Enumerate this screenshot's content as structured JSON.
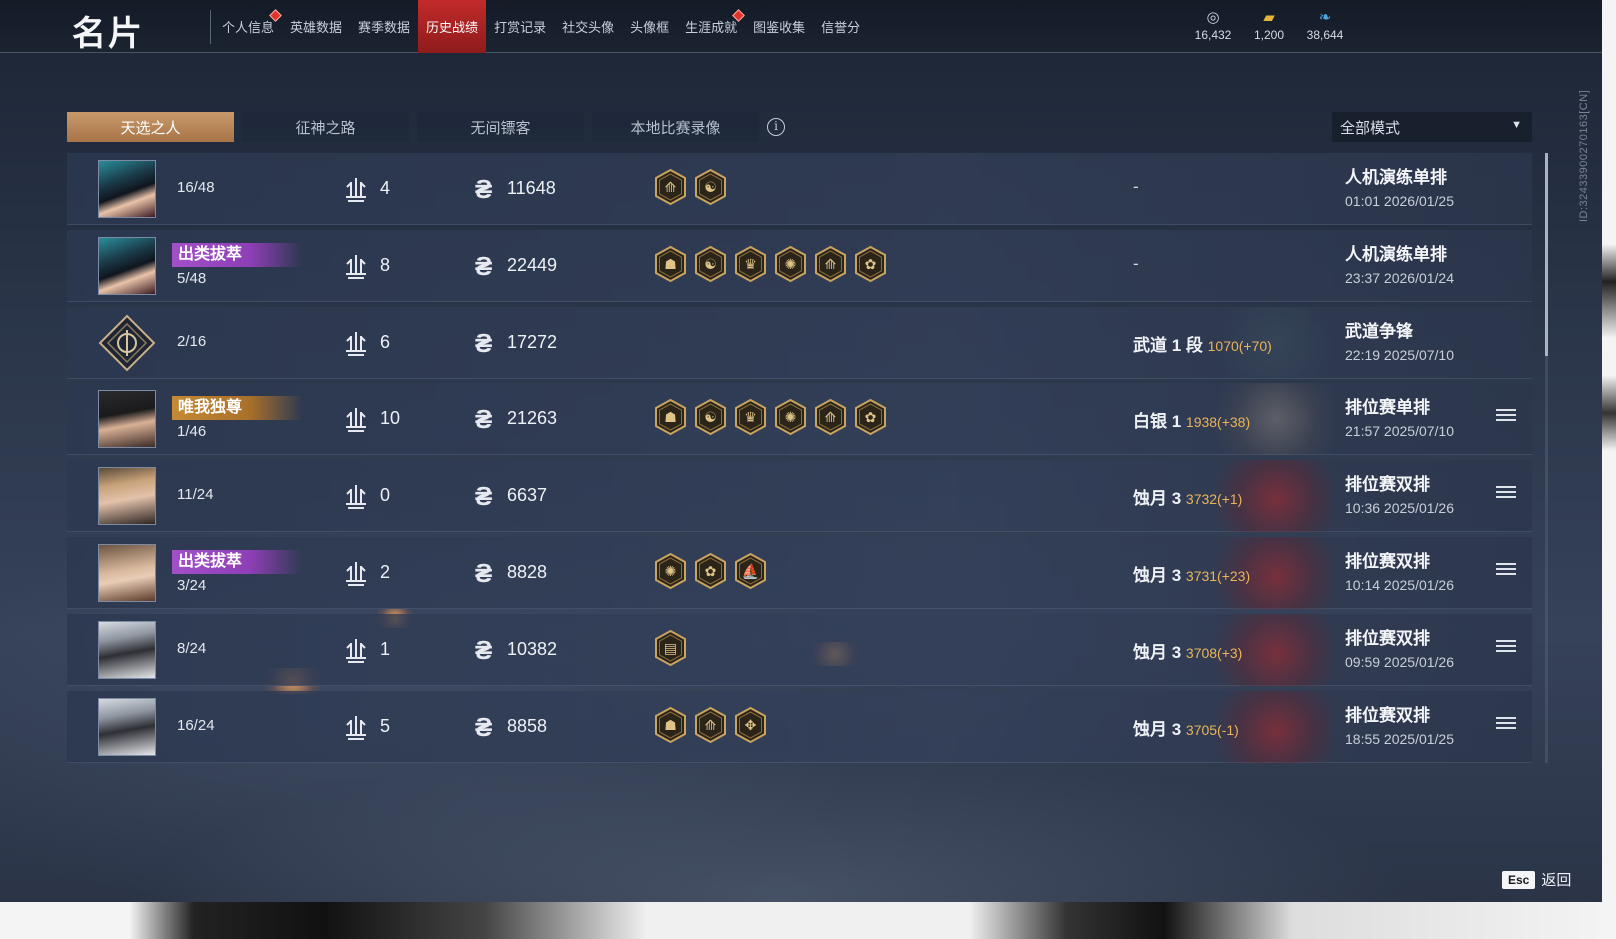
{
  "header": {
    "title": "名片",
    "nav": [
      {
        "label": "个人信息",
        "dot": true,
        "active": false
      },
      {
        "label": "英雄数据",
        "dot": false,
        "active": false
      },
      {
        "label": "赛季数据",
        "dot": false,
        "active": false
      },
      {
        "label": "历史战绩",
        "dot": false,
        "active": true
      },
      {
        "label": "打赏记录",
        "dot": false,
        "active": false
      },
      {
        "label": "社交头像",
        "dot": false,
        "active": false
      },
      {
        "label": "头像框",
        "dot": false,
        "active": false
      },
      {
        "label": "生涯成就",
        "dot": true,
        "active": false
      },
      {
        "label": "图鉴收集",
        "dot": false,
        "active": false
      },
      {
        "label": "信誉分",
        "dot": false,
        "active": false
      }
    ],
    "currencies": [
      {
        "icon": "silver-coin-icon",
        "value": "16,432"
      },
      {
        "icon": "gold-ticket-icon",
        "value": "1,200"
      },
      {
        "icon": "feather-icon",
        "value": "38,644"
      }
    ]
  },
  "side_id": "ID:3243390027016​3[CN]",
  "tabs": [
    "天选之人",
    "征神之路",
    "无间镖客",
    "本地比赛录像"
  ],
  "active_tab": 0,
  "mode_filter": {
    "value": "全部模式"
  },
  "matches": [
    {
      "avatar": "hooded-woman",
      "title": "",
      "title_style": "",
      "rank": "16/48",
      "kills": "4",
      "score": "11648",
      "medals": [
        "spear",
        "dragon"
      ],
      "tier": "",
      "tier_points": "",
      "dash": "-",
      "mode": "人机演练单排",
      "time": "01:01 2026/01/25",
      "has_detail": false,
      "art": ""
    },
    {
      "avatar": "hooded-woman",
      "title": "出类拔萃",
      "title_style": "purple",
      "rank": "5/48",
      "kills": "8",
      "score": "22449",
      "medals": [
        "mask",
        "dragon",
        "crown",
        "phoenix",
        "spear",
        "lotus"
      ],
      "tier": "",
      "tier_points": "",
      "dash": "-",
      "mode": "人机演练单排",
      "time": "23:37 2026/01/24",
      "has_detail": false,
      "art": ""
    },
    {
      "avatar": "diamond-emblem",
      "title": "",
      "title_style": "",
      "rank": "2/16",
      "kills": "6",
      "score": "17272",
      "medals": [],
      "tier": "武道 1 段",
      "tier_points": "1070(+70)",
      "dash": "",
      "mode": "武道争锋",
      "time": "22:19 2025/07/10",
      "has_detail": false,
      "art": "wd"
    },
    {
      "avatar": "young-swordsman",
      "title": "唯我独尊",
      "title_style": "gold",
      "rank": "1/46",
      "kills": "10",
      "score": "21263",
      "medals": [
        "mask",
        "dragon",
        "crown",
        "phoenix",
        "spear",
        "lotus"
      ],
      "tier": "白银 1",
      "tier_points": "1938(+38)",
      "dash": "",
      "mode": "排位赛单排",
      "time": "21:57 2025/07/10",
      "has_detail": true,
      "art": "silver"
    },
    {
      "avatar": "armored-woman",
      "title": "",
      "title_style": "",
      "rank": "11/24",
      "kills": "0",
      "score": "6637",
      "medals": [],
      "tier": "蚀月 3",
      "tier_points": "3732(+1)",
      "dash": "",
      "mode": "排位赛双排",
      "time": "10:36 2025/01/26",
      "has_detail": true,
      "art": "red"
    },
    {
      "avatar": "long-hair-woman",
      "title": "出类拔萃",
      "title_style": "purple",
      "rank": "3/24",
      "kills": "2",
      "score": "8828",
      "medals": [
        "phoenix",
        "lotus",
        "ship"
      ],
      "tier": "蚀月 3",
      "tier_points": "3731(+23)",
      "dash": "",
      "mode": "排位赛双排",
      "time": "10:14 2025/01/26",
      "has_detail": true,
      "art": "red"
    },
    {
      "avatar": "veiled-woman",
      "title": "",
      "title_style": "",
      "rank": "8/24",
      "kills": "1",
      "score": "10382",
      "medals": [
        "scroll"
      ],
      "tier": "蚀月 3",
      "tier_points": "3708(+3)",
      "dash": "",
      "mode": "排位赛双排",
      "time": "09:59 2025/01/26",
      "has_detail": true,
      "art": "red"
    },
    {
      "avatar": "veiled-woman",
      "title": "",
      "title_style": "",
      "rank": "16/24",
      "kills": "5",
      "score": "8858",
      "medals": [
        "mask",
        "spear",
        "wings"
      ],
      "tier": "蚀月 3",
      "tier_points": "3705(-1)",
      "dash": "",
      "mode": "排位赛双排",
      "time": "18:55 2025/01/25",
      "has_detail": true,
      "art": "red"
    }
  ],
  "footer": {
    "esc_key": "Esc",
    "back_label": "返回"
  },
  "colors": {
    "accent_red": "#c22a2a",
    "tab_active": "#b88354",
    "points": "#e9b45a",
    "title_purple": "#a250c8",
    "title_gold": "#c48a35"
  }
}
